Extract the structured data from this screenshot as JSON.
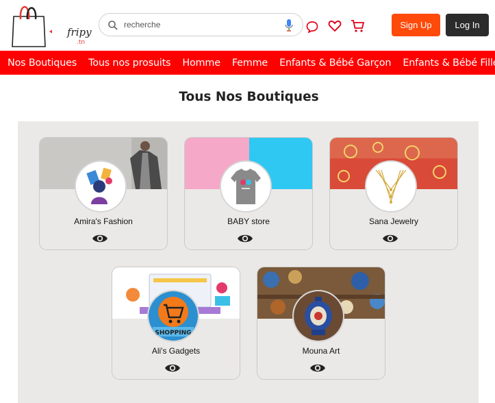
{
  "header": {
    "logo_text": "fripy",
    "logo_sub": ".tn",
    "search_placeholder": "recherche",
    "icons": [
      "search-icon",
      "mic-icon",
      "chat-icon",
      "heart-icon",
      "cart-icon"
    ],
    "signup_label": "Sign Up",
    "login_label": "Log In"
  },
  "nav": {
    "items": [
      {
        "label": "Nos Boutiques"
      },
      {
        "label": "Tous nos prosuits"
      },
      {
        "label": "Homme"
      },
      {
        "label": "Femme"
      },
      {
        "label": "Enfants & Bébé Garçon"
      },
      {
        "label": "Enfants & Bébé Fille"
      }
    ]
  },
  "main": {
    "title": "Tous Nos Boutiques",
    "shops": [
      {
        "name": "Amira's Fashion"
      },
      {
        "name": "BABY store"
      },
      {
        "name": "Sana Jewelry"
      },
      {
        "name": "Ali's Gadgets"
      },
      {
        "name": "Mouna Art"
      }
    ]
  },
  "colors": {
    "nav_bg": "#ff0000",
    "signup_bg": "#ff4a0a",
    "login_bg": "#2b2b2b",
    "container_bg": "#ebe9e7"
  }
}
